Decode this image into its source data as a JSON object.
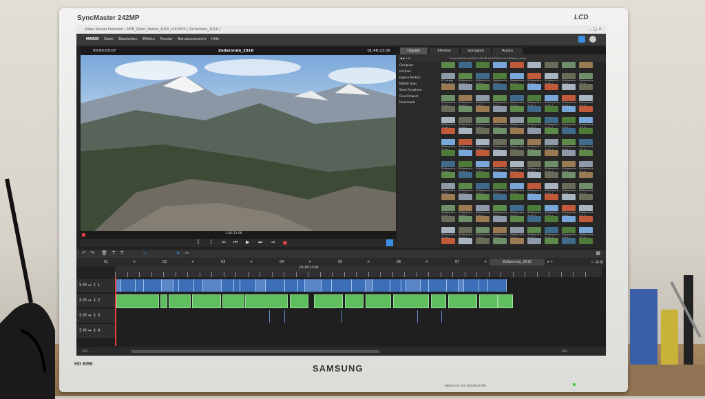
{
  "monitor": {
    "model": "SyncMaster 242MP",
    "badge": "LCD",
    "brand": "SAMSUNG",
    "left_logos": "HD BBE",
    "buttons_text": "MENU  CH  VOL  SOURCE  PIP"
  },
  "app": {
    "window_title": "Video deluxe Premium - MTB_Zeller_Ronda_2018_v16.MVP  [ Zellaronda_2018 ]",
    "logo": "MAGIX",
    "menu": [
      "Datei",
      "Bearbeiten",
      "Effekte",
      "Fenster",
      "Benutzeransicht",
      "Hilfe"
    ]
  },
  "preview": {
    "timecode_left": "00:00:05:07",
    "title": "Zellaronda_2018",
    "timecode_right": "01:46:23:06",
    "position_readout": "1:46:23:06"
  },
  "browser": {
    "tabs": [
      "Import",
      "Effekte",
      "Vorlagen",
      "Audio"
    ],
    "path": "D:\\data\\Bilder\\2018\\2018.08.20-MTB_Frank-Fl\\Bilder_video",
    "sidebar": [
      "Computer",
      "michael",
      "Eigene Medien",
      "MAGIX Tools",
      "Send Anywhere",
      "Cloud Import",
      "Downloads"
    ],
    "thumb_label": "Zellarond a-2018-1...",
    "first_thumb_label": "07-image mtb-2018..."
  },
  "timeline": {
    "chapters": [
      "01",
      "02",
      "03",
      "04",
      "05",
      "06",
      "07"
    ],
    "sequence_tab": "Zellaronda_2018",
    "ruler_marker": "01:46:23:06",
    "track_labels": [
      "S M ↔ ↕ 1",
      "S M ↔ ↕ 2",
      "S M ↔ ↕ 3",
      "S M ↔ ↕ 4"
    ],
    "zoom": "20%",
    "status": "CPU: —"
  },
  "colors": {
    "accent": "#3a8fe0",
    "video_clip": "#3d6fb8",
    "audio_clip": "#5fbf5f",
    "playhead": "#e04040"
  }
}
